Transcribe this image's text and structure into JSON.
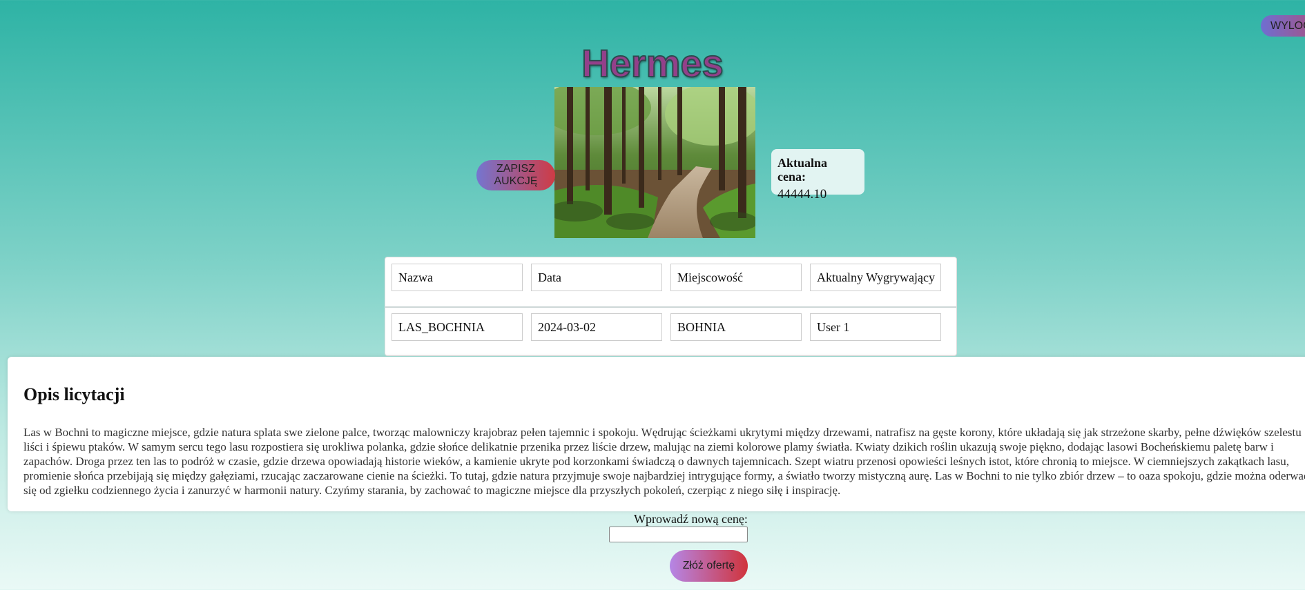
{
  "header": {
    "logout_label": "WYLOGUJ",
    "title": "Hermes"
  },
  "auction": {
    "save_label": "ZAPISZ AUKCJĘ",
    "price_label": "Aktualna cena:",
    "price_value": "44444.10"
  },
  "table": {
    "headers": [
      "Nazwa",
      "Data",
      "Miejscowość",
      "Aktualny Wygrywający"
    ],
    "rows": [
      [
        "LAS_BOCHNIA",
        "2024-03-02",
        "BOHNIA",
        "User 1"
      ]
    ]
  },
  "description": {
    "title": "Opis licytacji",
    "text": "Las w Bochni to magiczne miejsce, gdzie natura splata swe zielone palce, tworząc malowniczy krajobraz pełen tajemnic i spokoju. Wędrując ścieżkami ukrytymi między drzewami, natrafisz na gęste korony, które układają się jak strzeżone skarby, pełne dźwięków szelestu liści i śpiewu ptaków. W samym sercu tego lasu rozpostiera się urokliwa polanka, gdzie słońce delikatnie przenika przez liście drzew, malując na ziemi kolorowe plamy światła. Kwiaty dzikich roślin ukazują swoje piękno, dodając lasowi Bocheńskiemu paletę barw i zapachów. Droga przez ten las to podróż w czasie, gdzie drzewa opowiadają historie wieków, a kamienie ukryte pod korzonkami świadczą o dawnych tajemnicach. Szept wiatru przenosi opowieści leśnych istot, które chronią to miejsce. W ciemniejszych zakątkach lasu, promienie słońca przebijają się między gałęziami, rzucając zaczarowane cienie na ścieżki. To tutaj, gdzie natura przyjmuje swoje najbardziej intrygujące formy, a światło tworzy mistyczną aurę. Las w Bochni to nie tylko zbiór drzew – to oaza spokoju, gdzie można oderwać się od zgiełku codziennego życia i zanurzyć w harmonii natury. Czyńmy starania, by zachować to magiczne miejsce dla przyszłych pokoleń, czerpiąc z niego siłę i inspirację."
  },
  "bid": {
    "label": "Wprowadź nową cenę:",
    "input_value": "",
    "submit_label": "Złóż ofertę"
  },
  "colors": {
    "background_top": "#2eb3a5",
    "background_bottom": "#eaf9f6",
    "title": "#93408a",
    "button_gradient_start": "#7575d0",
    "button_gradient_end": "#cf3b45"
  }
}
